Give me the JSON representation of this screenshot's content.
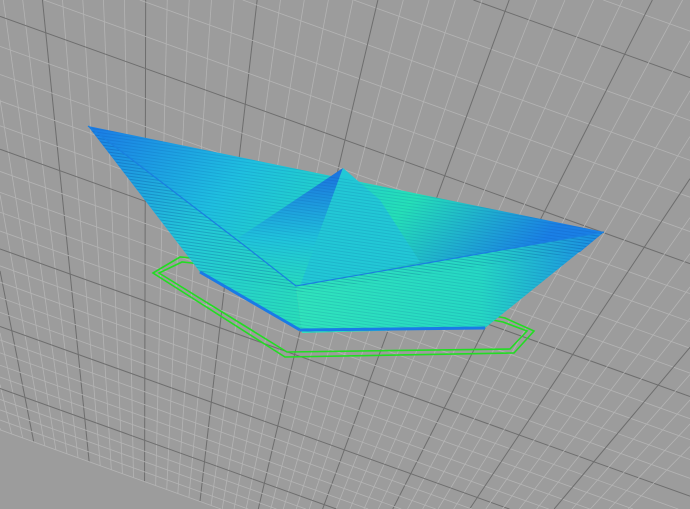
{
  "viewport": {
    "background_color": "#9c9c9c",
    "grid_minor_color": "#b4b4b4",
    "grid_major_color": "#6e6e6e",
    "model_colors": [
      "#1a7ae6",
      "#1fb8e8",
      "#22e0b0",
      "#3fe0c0"
    ],
    "outline_color": "#22dd22"
  }
}
